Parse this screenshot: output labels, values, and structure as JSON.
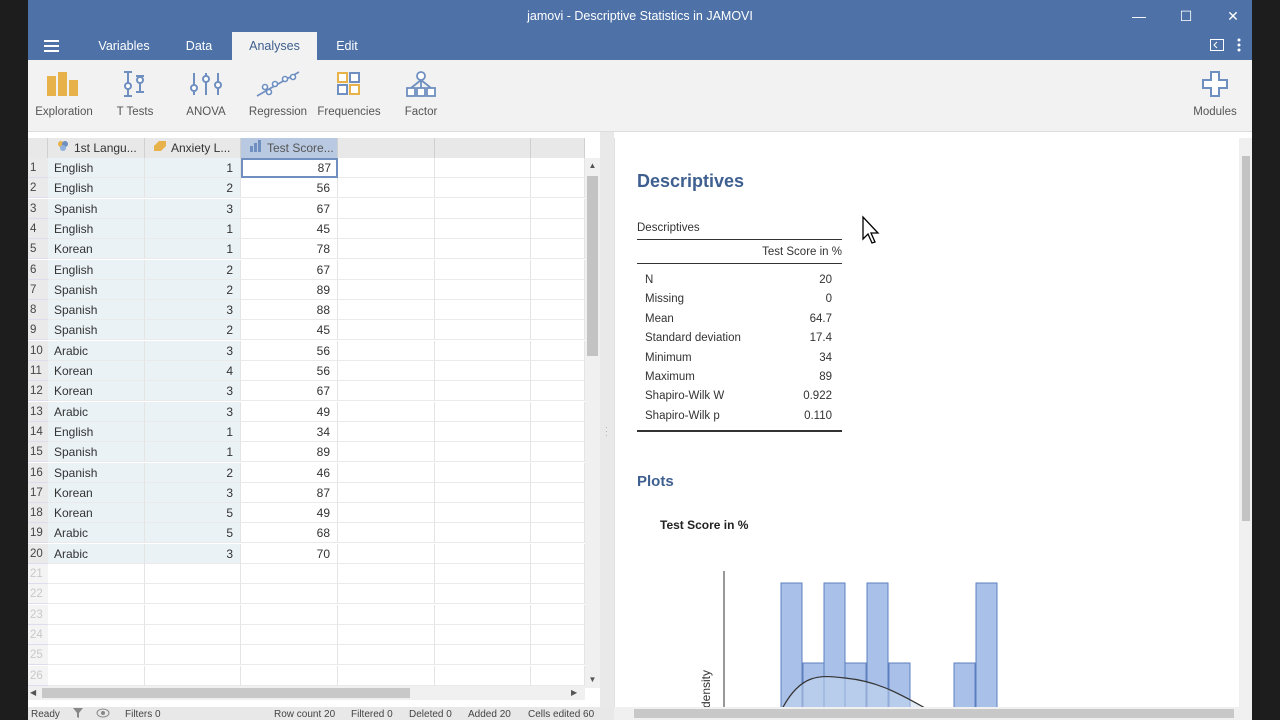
{
  "window": {
    "title": "jamovi - Descriptive Statistics in JAMOVI"
  },
  "tabs": [
    {
      "label": "Variables"
    },
    {
      "label": "Data"
    },
    {
      "label": "Analyses"
    },
    {
      "label": "Edit"
    }
  ],
  "ribbon": {
    "items": [
      {
        "label": "Exploration",
        "icon": "exploration-icon"
      },
      {
        "label": "T Tests",
        "icon": "t-tests-icon"
      },
      {
        "label": "ANOVA",
        "icon": "anova-icon"
      },
      {
        "label": "Regression",
        "icon": "regression-icon"
      },
      {
        "label": "Frequencies",
        "icon": "frequencies-icon"
      },
      {
        "label": "Factor",
        "icon": "factor-icon"
      }
    ],
    "modules": {
      "label": "Modules",
      "icon": "plus-icon"
    }
  },
  "sheet": {
    "columns": [
      {
        "label": "1st Langu...",
        "icon": "nominal-icon"
      },
      {
        "label": "Anxiety L...",
        "icon": "ordinal-icon"
      },
      {
        "label": "Test Score...",
        "icon": "continuous-icon"
      }
    ],
    "rows": [
      [
        "English",
        "1",
        "87"
      ],
      [
        "English",
        "2",
        "56"
      ],
      [
        "Spanish",
        "3",
        "67"
      ],
      [
        "English",
        "1",
        "45"
      ],
      [
        "Korean",
        "1",
        "78"
      ],
      [
        "English",
        "2",
        "67"
      ],
      [
        "Spanish",
        "2",
        "89"
      ],
      [
        "Spanish",
        "3",
        "88"
      ],
      [
        "Spanish",
        "2",
        "45"
      ],
      [
        "Arabic",
        "3",
        "56"
      ],
      [
        "Korean",
        "4",
        "56"
      ],
      [
        "Korean",
        "3",
        "67"
      ],
      [
        "Arabic",
        "3",
        "49"
      ],
      [
        "English",
        "1",
        "34"
      ],
      [
        "Spanish",
        "1",
        "89"
      ],
      [
        "Spanish",
        "2",
        "46"
      ],
      [
        "Korean",
        "3",
        "87"
      ],
      [
        "Korean",
        "5",
        "49"
      ],
      [
        "Arabic",
        "5",
        "68"
      ],
      [
        "Arabic",
        "3",
        "70"
      ]
    ],
    "empty_rows": [
      "21",
      "22",
      "23",
      "24",
      "25",
      "26"
    ]
  },
  "status": {
    "ready": "Ready",
    "filters": "Filters 0",
    "row_count": "Row count 20",
    "filtered": "Filtered 0",
    "deleted": "Deleted 0",
    "added": "Added 20",
    "cells_edited": "Cells edited 60"
  },
  "results": {
    "heading": "Descriptives",
    "table": {
      "title": "Descriptives",
      "column": "Test Score in %",
      "rows": [
        {
          "label": "N",
          "value": "20"
        },
        {
          "label": "Missing",
          "value": "0"
        },
        {
          "label": "Mean",
          "value": "64.7"
        },
        {
          "label": "Standard deviation",
          "value": "17.4"
        },
        {
          "label": "Minimum",
          "value": "34"
        },
        {
          "label": "Maximum",
          "value": "89"
        },
        {
          "label": "Shapiro-Wilk W",
          "value": "0.922"
        },
        {
          "label": "Shapiro-Wilk p",
          "value": "0.110"
        }
      ]
    },
    "plots_heading": "Plots",
    "plot_title": "Test Score in %",
    "plot_ylabel": "density"
  },
  "colors": {
    "accent": "#4e72a8",
    "heading": "#3e5f8f",
    "bar_fill": "#a9c0e8",
    "bar_stroke": "#5d7fbf"
  }
}
